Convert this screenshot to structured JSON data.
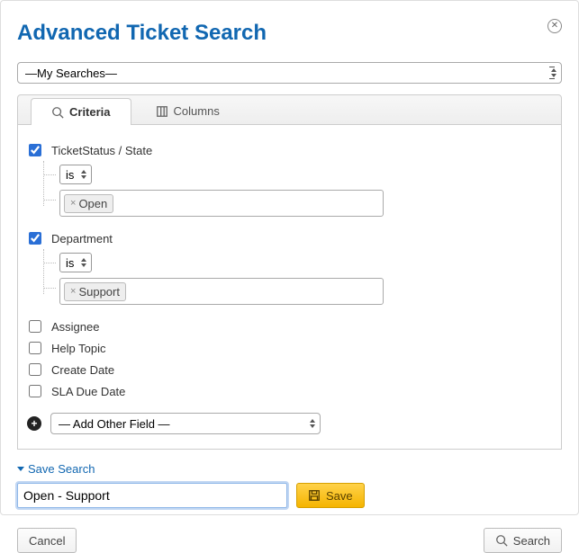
{
  "title": "Advanced Ticket Search",
  "my_searches_label": "—My Searches—",
  "tabs": {
    "criteria": "Criteria",
    "columns": "Columns"
  },
  "criteria": [
    {
      "checked": true,
      "label": "TicketStatus / State",
      "op": "is",
      "token": "Open"
    },
    {
      "checked": true,
      "label": "Department",
      "op": "is",
      "token": "Support"
    },
    {
      "checked": false,
      "label": "Assignee"
    },
    {
      "checked": false,
      "label": "Help Topic"
    },
    {
      "checked": false,
      "label": "Create Date"
    },
    {
      "checked": false,
      "label": "SLA Due Date"
    }
  ],
  "add_other_field_label": "— Add Other Field —",
  "save_search": {
    "header": "Save Search",
    "name_value": "Open - Support",
    "save_btn": "Save"
  },
  "footer": {
    "cancel": "Cancel",
    "search": "Search"
  }
}
